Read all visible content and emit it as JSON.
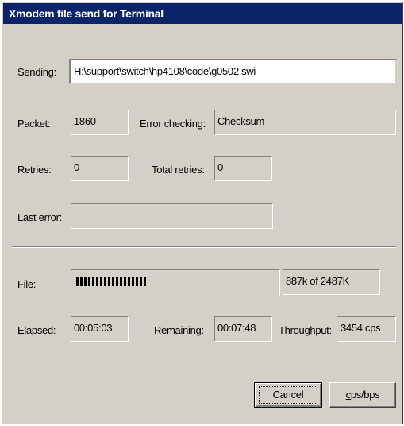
{
  "window": {
    "title": "Xmodem file send for Terminal"
  },
  "sending": {
    "label": "Sending:",
    "value": "H:\\support\\switch\\hp4108\\code\\g0502.swi"
  },
  "packet": {
    "label": "Packet:",
    "value": "1860"
  },
  "error_checking": {
    "label": "Error checking:",
    "value": "Checksum"
  },
  "retries": {
    "label": "Retries:",
    "value": "0"
  },
  "total_retries": {
    "label": "Total retries:",
    "value": "0"
  },
  "last_error": {
    "label": "Last error:",
    "value": ""
  },
  "file": {
    "label": "File:",
    "progress_fraction": 0.357,
    "status": "887k of 2487K"
  },
  "elapsed": {
    "label": "Elapsed:",
    "value": "00:05:03"
  },
  "remaining": {
    "label": "Remaining:",
    "value": "00:07:48"
  },
  "throughput": {
    "label": "Throughput:",
    "value": "3454 cps"
  },
  "buttons": {
    "cancel": "Cancel",
    "cps_bps_first": "c",
    "cps_bps_rest": "ps/bps"
  }
}
